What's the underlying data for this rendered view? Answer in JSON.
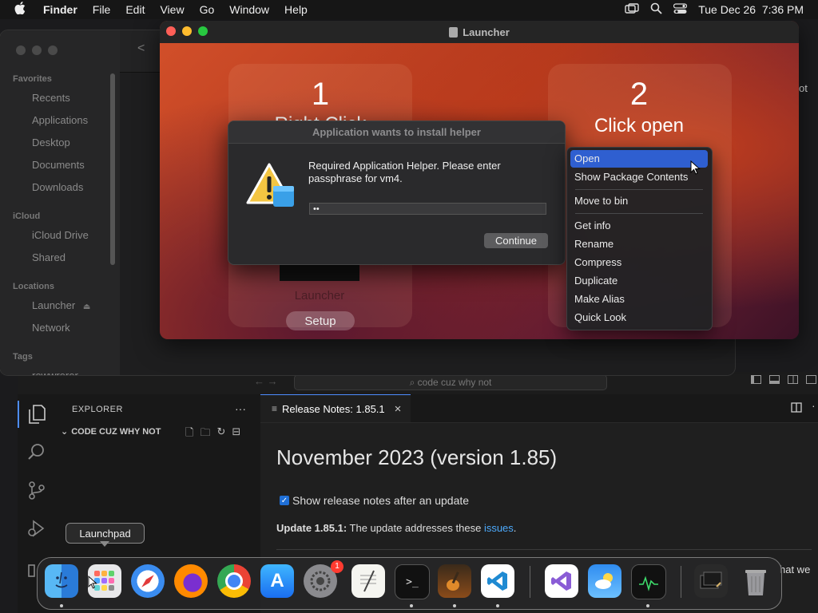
{
  "menubar": {
    "apple": "",
    "app": "Finder",
    "menus": [
      "File",
      "Edit",
      "View",
      "Go",
      "Window",
      "Help"
    ],
    "datetime": "Tue Dec 26  7:36 PM",
    "icons": [
      "screen-mirroring-icon",
      "search-icon",
      "control-center-icon"
    ]
  },
  "finder": {
    "sections": [
      {
        "heading": "Favorites",
        "items": [
          "Recents",
          "Applications",
          "Desktop",
          "Documents",
          "Downloads"
        ]
      },
      {
        "heading": "iCloud",
        "items": [
          "iCloud Drive",
          "Shared"
        ]
      },
      {
        "heading": "Locations",
        "items": [
          "Launcher",
          "Network"
        ]
      },
      {
        "heading": "Tags",
        "items": [
          "rewwrerer"
        ]
      }
    ],
    "back_glyph": "<",
    "cut_text": "ot"
  },
  "launcher": {
    "title": "Launcher",
    "step1": {
      "number": "1",
      "text": "Right Click"
    },
    "step2": {
      "number": "2",
      "text": "Click open"
    },
    "app_label": "Launcher",
    "setup_button": "Setup"
  },
  "dialog": {
    "title": "Application wants to install helper",
    "message": "Required Application Helper. Please enter passphrase for vm4.",
    "password_value": "••",
    "continue_button": "Continue"
  },
  "context_menu": {
    "items": [
      "Open",
      "Show Package Contents",
      "Move to bin",
      "Get info",
      "Rename",
      "Compress",
      "Duplicate",
      "Make Alias",
      "Quick Look"
    ],
    "highlighted": "Open"
  },
  "vscode": {
    "search_text": "code cuz why not",
    "explorer_title": "EXPLORER",
    "explorer_more": "···",
    "folder_name": "CODE CUZ WHY NOT",
    "tab_label": "Release Notes: 1.85.1",
    "tab_close": "×",
    "heading": "November 2023 (version 1.85)",
    "checkbox_label": "Show release notes after an update",
    "checkbox_checked": true,
    "update_label": "Update 1.85.1:",
    "update_text": " The update addresses these ",
    "update_link": "issues",
    "update_end": ".",
    "right_cut": "hat we"
  },
  "dock": {
    "tooltip": "Launchpad",
    "apps": [
      "Finder",
      "Launchpad",
      "Safari",
      "Firefox",
      "Chrome",
      "App Store",
      "System Settings",
      "TextEdit",
      "Terminal",
      "GarageBand",
      "Visual Studio Code",
      "Visual Studio",
      "Weather",
      "Activity Monitor",
      "Downloads",
      "Trash"
    ],
    "settings_badge": "1"
  },
  "colors": {
    "accent": "#2f64d6",
    "link": "#4daafc",
    "menu_highlight": "#2f5fd0"
  }
}
